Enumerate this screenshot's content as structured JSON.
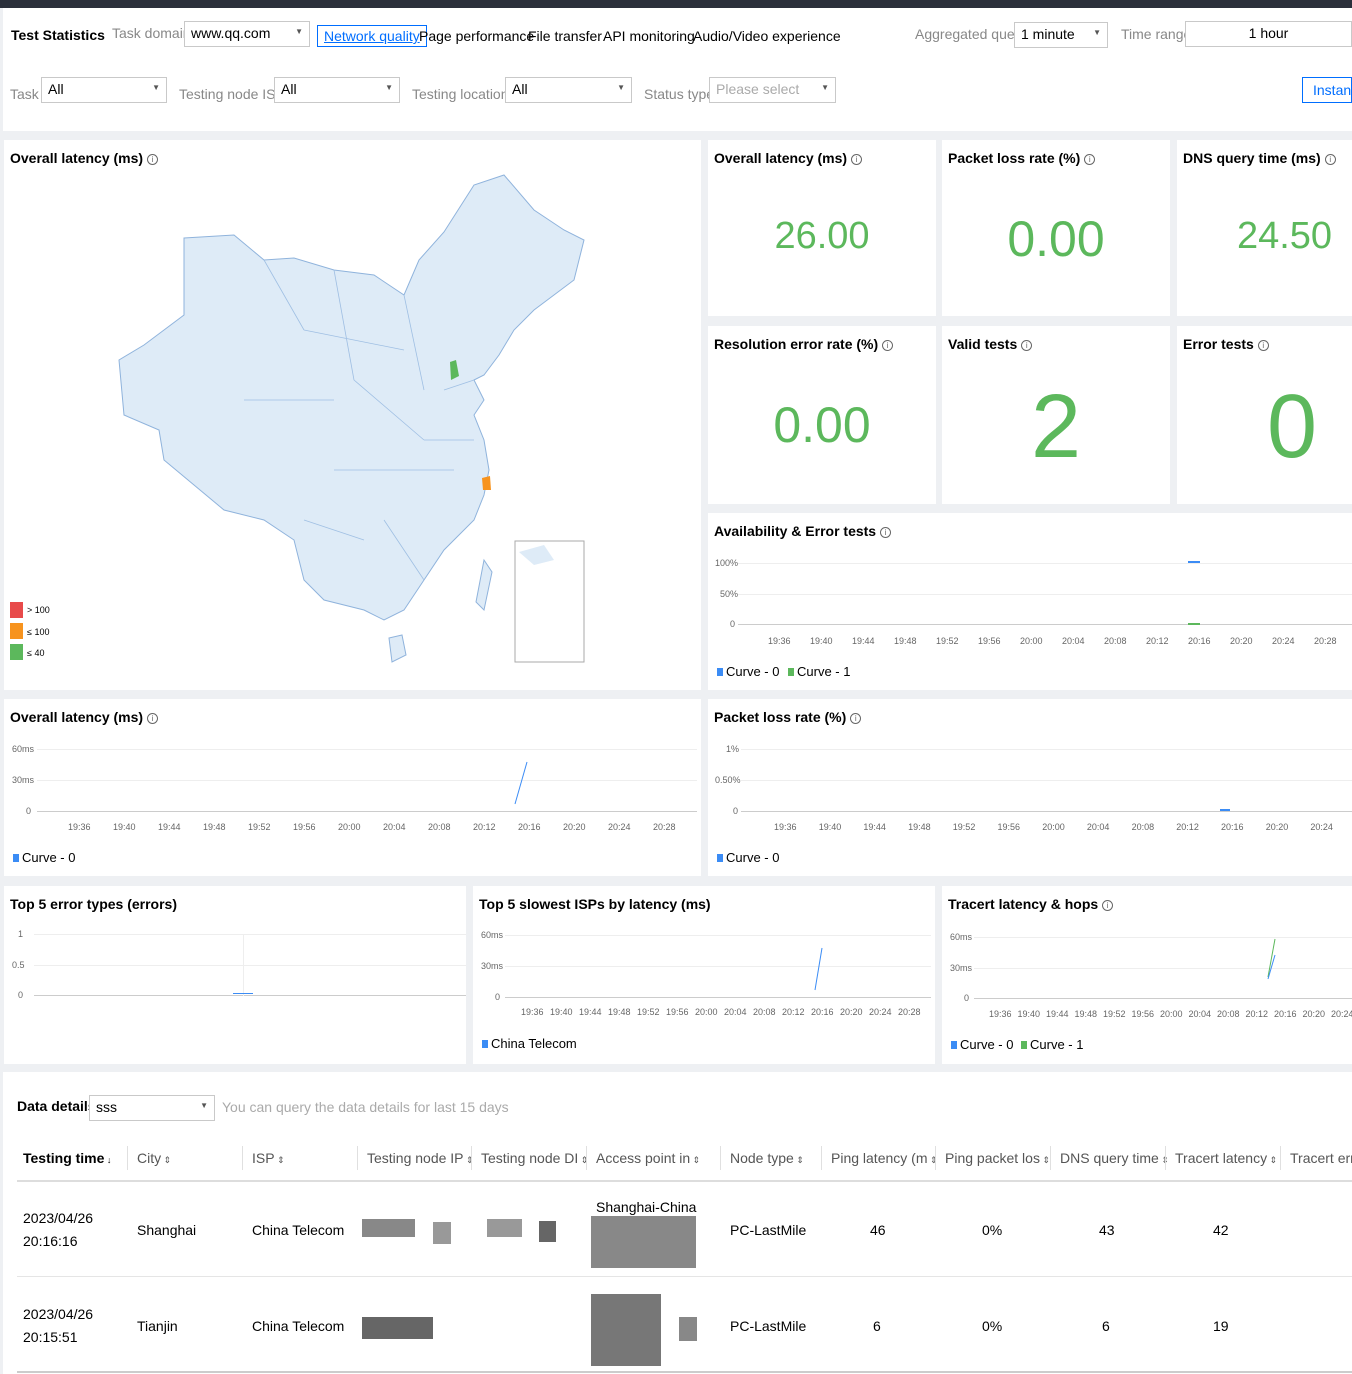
{
  "header": {
    "title": "Test Statistics",
    "task_domain_label": "Task domain",
    "task_domain_value": "www.qq.com",
    "tabs": [
      "Network quality",
      "Page performance",
      "File transfer",
      "API monitoring",
      "Audio/Video experience"
    ],
    "aggregated_label": "Aggregated query",
    "aggregated_value": "1 minute",
    "time_range_label": "Time range",
    "time_range_value": "1 hour"
  },
  "filters": {
    "task_label": "Task",
    "task_value": "All",
    "isp_label": "Testing node ISP",
    "isp_value": "All",
    "locations_label": "Testing locations",
    "locations_value": "All",
    "status_label": "Status type",
    "status_placeholder": "Please select",
    "instant_button": "Instant"
  },
  "map_card": {
    "title": "Overall latency (ms)",
    "legend": [
      {
        "label": "> 100",
        "color": "#e84a4a"
      },
      {
        "label": "≤ 100",
        "color": "#f7931e"
      },
      {
        "label": "≤ 40",
        "color": "#5cb85c"
      }
    ]
  },
  "stats": [
    {
      "title": "Overall latency (ms)",
      "value": "26.00"
    },
    {
      "title": "Packet loss rate (%)",
      "value": "0.00"
    },
    {
      "title": "DNS query time (ms)",
      "value": "24.50"
    },
    {
      "title": "Resolution error rate (%)",
      "value": "0.00"
    },
    {
      "title": "Valid tests",
      "value": "2"
    },
    {
      "title": "Error tests",
      "value": "0"
    }
  ],
  "charts": {
    "availability": {
      "title": "Availability & Error tests",
      "y_ticks": [
        "100%",
        "50%",
        "0"
      ],
      "x_ticks": [
        "19:36",
        "19:40",
        "19:44",
        "19:48",
        "19:52",
        "19:56",
        "20:00",
        "20:04",
        "20:08",
        "20:12",
        "20:16",
        "20:20",
        "20:24",
        "20:28"
      ],
      "legend": [
        "Curve - 0",
        "Curve - 1"
      ]
    },
    "latency": {
      "title": "Overall latency (ms)",
      "y_ticks": [
        "60ms",
        "30ms",
        "0"
      ],
      "x_ticks": [
        "19:36",
        "19:40",
        "19:44",
        "19:48",
        "19:52",
        "19:56",
        "20:00",
        "20:04",
        "20:08",
        "20:12",
        "20:16",
        "20:20",
        "20:24",
        "20:28"
      ],
      "legend": [
        "Curve - 0"
      ]
    },
    "packet_loss": {
      "title": "Packet loss rate (%)",
      "y_ticks": [
        "1%",
        "0.50%",
        "0"
      ],
      "x_ticks": [
        "19:36",
        "19:40",
        "19:44",
        "19:48",
        "19:52",
        "19:56",
        "20:00",
        "20:04",
        "20:08",
        "20:12",
        "20:16",
        "20:20",
        "20:24"
      ],
      "legend": [
        "Curve - 0"
      ]
    },
    "errors": {
      "title": "Top 5 error types (errors)",
      "y_ticks": [
        "1",
        "0.5",
        "0"
      ]
    },
    "slow_isps": {
      "title": "Top 5 slowest ISPs by latency (ms)",
      "y_ticks": [
        "60ms",
        "30ms",
        "0"
      ],
      "x_ticks": [
        "19:36",
        "19:40",
        "19:44",
        "19:48",
        "19:52",
        "19:56",
        "20:00",
        "20:04",
        "20:08",
        "20:12",
        "20:16",
        "20:20",
        "20:24",
        "20:28"
      ],
      "legend": [
        "China Telecom"
      ]
    },
    "tracert": {
      "title": "Tracert latency & hops",
      "y_ticks": [
        "60ms",
        "30ms",
        "0"
      ],
      "x_ticks": [
        "19:36",
        "19:40",
        "19:44",
        "19:48",
        "19:52",
        "19:56",
        "20:00",
        "20:04",
        "20:08",
        "20:12",
        "20:16",
        "20:20",
        "20:24"
      ],
      "legend": [
        "Curve - 0",
        "Curve - 1"
      ]
    }
  },
  "details": {
    "label": "Data details",
    "select_value": "sss",
    "hint": "You can query the data details for last 15 days",
    "columns": [
      "Testing time",
      "City",
      "ISP",
      "Testing node IP",
      "Testing node DI",
      "Access point in",
      "Node type",
      "Ping latency (m",
      "Ping packet los",
      "DNS query time",
      "Tracert latency",
      "Tracert erro"
    ],
    "rows": [
      {
        "date": "2023/04/26",
        "time": "20:16:16",
        "city": "Shanghai",
        "isp": "China Telecom",
        "access": "Shanghai-China",
        "node_type": "PC-LastMile",
        "ping": "46",
        "loss": "0%",
        "dns": "43",
        "tracert": "42"
      },
      {
        "date": "2023/04/26",
        "time": "20:15:51",
        "city": "Tianjin",
        "isp": "China Telecom",
        "access": "",
        "node_type": "PC-LastMile",
        "ping": "6",
        "loss": "0%",
        "dns": "6",
        "tracert": "19"
      }
    ]
  },
  "colors": {
    "blue": "#3b8cf5",
    "green": "#5cb85c",
    "accent": "#006eff"
  }
}
